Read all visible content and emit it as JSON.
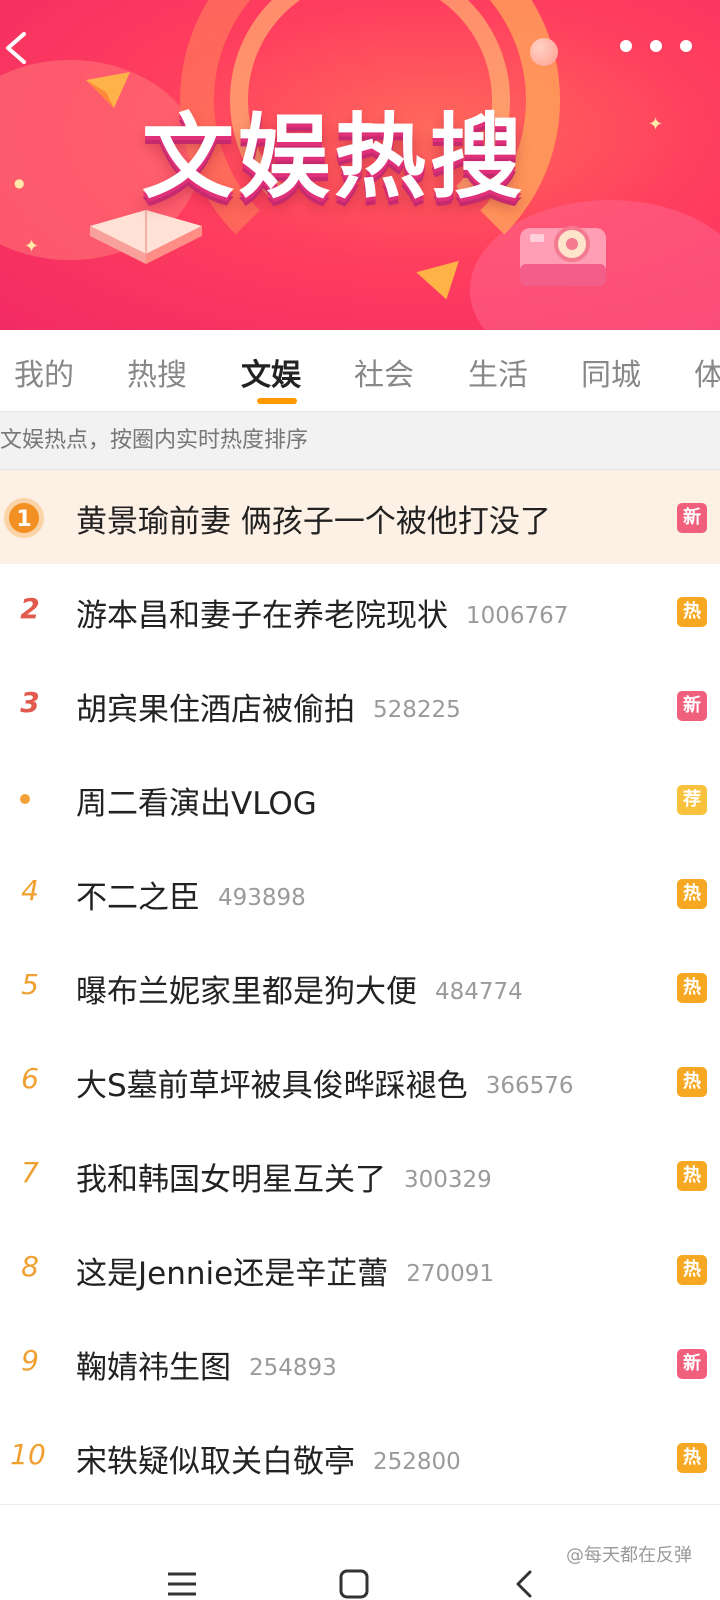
{
  "banner": {
    "title": "文娱热搜",
    "back_icon": "chevron-left-icon",
    "more_icon": "more-dots-icon"
  },
  "tabs": [
    {
      "label": "我的",
      "active": false
    },
    {
      "label": "热搜",
      "active": false
    },
    {
      "label": "文娱",
      "active": true
    },
    {
      "label": "社会",
      "active": false
    },
    {
      "label": "生活",
      "active": false
    },
    {
      "label": "同城",
      "active": false
    },
    {
      "label": "体",
      "active": false
    }
  ],
  "subheader": "文娱热点，按圈内实时热度排序",
  "list": [
    {
      "rank": "1",
      "title": "黄景瑜前妻 俩孩子一个被他打没了",
      "count": "",
      "badge": "新",
      "badge_type": "new"
    },
    {
      "rank": "2",
      "title": "游本昌和妻子在养老院现状",
      "count": "1006767",
      "badge": "热",
      "badge_type": "hot"
    },
    {
      "rank": "3",
      "title": "胡宾果住酒店被偷拍",
      "count": "528225",
      "badge": "新",
      "badge_type": "new"
    },
    {
      "rank": "•",
      "title": "周二看演出VLOG",
      "count": "",
      "badge": "荐",
      "badge_type": "rec"
    },
    {
      "rank": "4",
      "title": "不二之臣",
      "count": "493898",
      "badge": "热",
      "badge_type": "hot"
    },
    {
      "rank": "5",
      "title": "曝布兰妮家里都是狗大便",
      "count": "484774",
      "badge": "热",
      "badge_type": "hot"
    },
    {
      "rank": "6",
      "title": "大S墓前草坪被具俊晔踩褪色",
      "count": "366576",
      "badge": "热",
      "badge_type": "hot"
    },
    {
      "rank": "7",
      "title": "我和韩国女明星互关了",
      "count": "300329",
      "badge": "热",
      "badge_type": "hot"
    },
    {
      "rank": "8",
      "title": "这是Jennie还是辛芷蕾",
      "count": "270091",
      "badge": "热",
      "badge_type": "hot"
    },
    {
      "rank": "9",
      "title": "鞠婧祎生图",
      "count": "254893",
      "badge": "新",
      "badge_type": "new"
    },
    {
      "rank": "10",
      "title": "宋轶疑似取关白敬亭",
      "count": "252800",
      "badge": "热",
      "badge_type": "hot"
    }
  ],
  "colors": {
    "accent": "#ff9900",
    "badge_new": "#f0607d",
    "badge_hot": "#f6a823",
    "rank_top": "#e25a4d",
    "rank_other": "#f0a030"
  },
  "navbar": {
    "menu_icon": "menu-icon",
    "home_icon": "home-square-icon",
    "back_icon": "back-chevron-icon"
  },
  "watermark": "@每天都在反弹"
}
